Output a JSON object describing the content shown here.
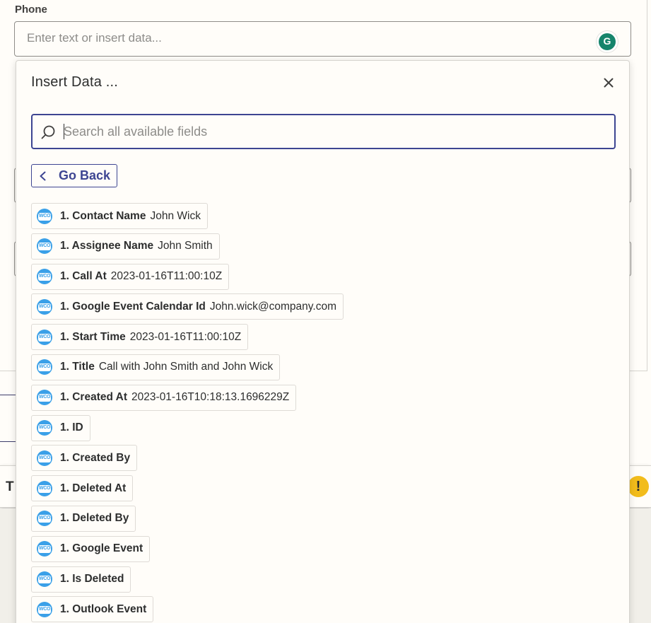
{
  "phone_field": {
    "label": "Phone",
    "placeholder": "Enter text or insert data...",
    "grammarly_letter": "G"
  },
  "background": {
    "bar_text": "T"
  },
  "popover": {
    "title": "Insert Data ...",
    "search_placeholder": "Search all available fields",
    "back_label": "Go Back",
    "fields": [
      {
        "key": "1. Contact Name",
        "value": "John Wick"
      },
      {
        "key": "1. Assignee Name",
        "value": "John Smith"
      },
      {
        "key": "1. Call At",
        "value": "2023-01-16T11:00:10Z"
      },
      {
        "key": "1. Google Event Calendar Id",
        "value": "John.wick@company.com"
      },
      {
        "key": "1. Start Time",
        "value": "2023-01-16T11:00:10Z"
      },
      {
        "key": "1. Title",
        "value": "Call with John Smith and John Wick"
      },
      {
        "key": "1. Created At",
        "value": "2023-01-16T10:18:13.1696229Z"
      },
      {
        "key": "1. ID",
        "value": ""
      },
      {
        "key": "1. Created By",
        "value": ""
      },
      {
        "key": "1. Deleted At",
        "value": ""
      },
      {
        "key": "1. Deleted By",
        "value": ""
      },
      {
        "key": "1. Google Event",
        "value": ""
      },
      {
        "key": "1. Is Deleted",
        "value": ""
      },
      {
        "key": "1. Outlook Event",
        "value": ""
      }
    ],
    "field_icon_text": "WCO"
  },
  "colors": {
    "accent": "#3d4592",
    "icon_blue": "#3aa0e8",
    "grammarly_green": "#15846b",
    "warning_yellow": "#f2bc1b"
  },
  "icons": {
    "close": "close-icon",
    "search": "search-icon",
    "back": "chevron-left-icon",
    "field": "woo-app-icon",
    "warning": "warning-icon",
    "grammarly": "grammarly-icon"
  }
}
